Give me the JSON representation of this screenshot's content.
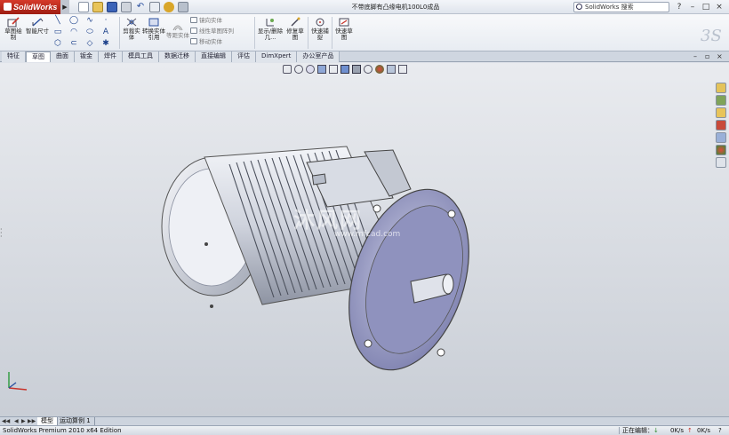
{
  "app": {
    "brand": "SolidWorks",
    "document_title": "不带底脚有凸缘电机100L0成品",
    "search_placeholder": "SolidWorks 搜索",
    "window_controls": [
      "?",
      "–",
      "□",
      "×"
    ]
  },
  "ribbon": {
    "sketch_button": "草图绘制",
    "smart_dim_button": "智能尺寸",
    "trim_button": "剪裁实体",
    "convert_button": "转换实体引用",
    "offset_button": "等距实体",
    "mirror_label": "镜向实体",
    "linear_pattern_label": "线性草图阵列",
    "move_label": "移动实体",
    "display_relations_button": "显示/删除几...",
    "repair_sketch_button": "修复草图",
    "quick_snaps_button": "快速捕捉",
    "rapid_sketch_button": "快速草图"
  },
  "tabs": [
    {
      "label": "特征",
      "active": false
    },
    {
      "label": "草图",
      "active": true
    },
    {
      "label": "曲面",
      "active": false
    },
    {
      "label": "钣金",
      "active": false
    },
    {
      "label": "焊件",
      "active": false
    },
    {
      "label": "模具工具",
      "active": false
    },
    {
      "label": "数据迁移",
      "active": false
    },
    {
      "label": "直接编辑",
      "active": false
    },
    {
      "label": "评估",
      "active": false
    },
    {
      "label": "DimXpert",
      "active": false
    },
    {
      "label": "办公室产品",
      "active": false
    }
  ],
  "viewport": {
    "watermark_cn": "沐风网",
    "watermark_url": "www.mfcad.com"
  },
  "model_tabs": [
    {
      "label": "模型",
      "active": true
    },
    {
      "label": "运动算例 1",
      "active": false
    }
  ],
  "status": {
    "edition": "SolidWorks Premium 2010 x64 Edition",
    "editing": "正在编辑：",
    "part": "零件",
    "down_rate": "0K/s",
    "up_rate": "0K/s"
  },
  "colors": {
    "brand_red": "#c0281a",
    "viewport_top": "#e9ebef",
    "viewport_bottom": "#c9ced6",
    "motor_body": "#cfd3dd",
    "flange_face": "#9a9cc6"
  }
}
